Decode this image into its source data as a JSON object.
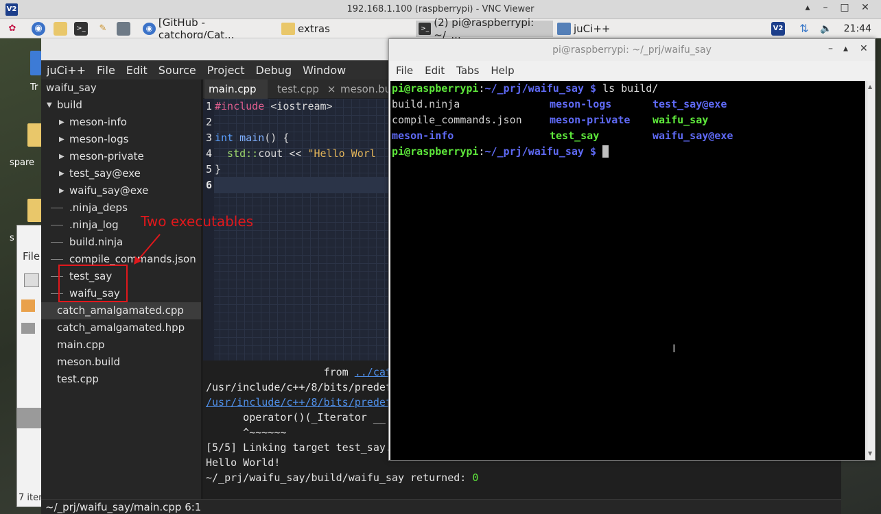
{
  "vnc": {
    "title": "192.168.1.100 (raspberrypi) - VNC Viewer",
    "logo": "V2"
  },
  "taskbar": {
    "tasks": [
      {
        "label": "[GitHub - catchorg/Cat...",
        "icon": "chromium-icon"
      },
      {
        "label": "extras",
        "icon": "folder-icon"
      },
      {
        "label": "(2) pi@raspberrypi: ~/_...",
        "icon": "terminal-icon"
      },
      {
        "label": "juCi++",
        "icon": "juci-icon"
      }
    ],
    "clock": "21:44"
  },
  "desktop": {
    "labels": [
      "Tr",
      "spare",
      "s"
    ]
  },
  "filemanager": {
    "menu": "File",
    "status": "7 iter"
  },
  "juci": {
    "menu": [
      "juCi++",
      "File",
      "Edit",
      "Source",
      "Project",
      "Debug",
      "Window"
    ],
    "tree": [
      {
        "label": "waifu_say",
        "type": "root"
      },
      {
        "label": "build",
        "type": "open"
      },
      {
        "label": "meson-info",
        "type": "closed"
      },
      {
        "label": "meson-logs",
        "type": "closed"
      },
      {
        "label": "meson-private",
        "type": "closed"
      },
      {
        "label": "test_say@exe",
        "type": "closed"
      },
      {
        "label": "waifu_say@exe",
        "type": "closed"
      },
      {
        "label": ".ninja_deps",
        "type": "file"
      },
      {
        "label": ".ninja_log",
        "type": "file"
      },
      {
        "label": "build.ninja",
        "type": "file"
      },
      {
        "label": "compile_commands.json",
        "type": "file"
      },
      {
        "label": "test_say",
        "type": "file"
      },
      {
        "label": "waifu_say",
        "type": "file"
      },
      {
        "label": "catch_amalgamated.cpp",
        "type": "top",
        "selected": true
      },
      {
        "label": "catch_amalgamated.hpp",
        "type": "top"
      },
      {
        "label": "main.cpp",
        "type": "top"
      },
      {
        "label": "meson.build",
        "type": "top"
      },
      {
        "label": "test.cpp",
        "type": "top"
      }
    ],
    "tabs": [
      "main.cpp",
      "test.cpp",
      "meson.bu"
    ],
    "close_glyph": "×",
    "code": {
      "line_numbers": [
        "1",
        "2",
        "3",
        "4",
        "5",
        "6"
      ],
      "l1_kw": "#include",
      "l1_rest": " <iostream>",
      "l3_kw": "int",
      "l3_fn": " main",
      "l3_rest": "() {",
      "l4_ns": "  std::",
      "l4_id": "cout",
      "l4_op": " << ",
      "l4_str": "\"Hello Worl",
      "l5": "}"
    },
    "console": [
      {
        "text": "                   from ",
        "link": "../catch"
      },
      {
        "text": "/usr/include/c++/8/bits/predef"
      },
      {
        "link_only": "/usr/include/c++/8/bits/predef"
      },
      {
        "text": "      operator()(_Iterator __"
      },
      {
        "text": "      ^~~~~~~"
      },
      {
        "text": "[5/5] Linking target test_say."
      },
      {
        "text": "Hello World!"
      },
      {
        "text": "~/_prj/waifu_say/build/waifu_say returned: ",
        "num": "0"
      }
    ],
    "status": "~/_prj/waifu_say/main.cpp 6:1"
  },
  "terminal": {
    "title": "pi@raspberrypi: ~/_prj/waifu_say",
    "menu": [
      "File",
      "Edit",
      "Tabs",
      "Help"
    ],
    "prompt_user": "pi@raspberrypi",
    "prompt_sep": ":",
    "prompt_path": "~/_prj/waifu_say $",
    "command": " ls build/",
    "listing": [
      [
        "build.ninja",
        "meson-logs",
        "test_say@exe"
      ],
      [
        "compile_commands.json",
        "meson-private",
        "waifu_say"
      ],
      [
        "meson-info",
        "test_say",
        "waifu_say@exe"
      ]
    ],
    "cursor": " "
  },
  "annotation": {
    "text": "Two executables",
    "color": "#e0181c"
  },
  "colors": {
    "prompt_green": "#5ee83b",
    "dir_blue": "#5f6af5",
    "exe_green": "#5ee83b",
    "keyword": "#5aa0ff",
    "string": "#e2b45a"
  }
}
